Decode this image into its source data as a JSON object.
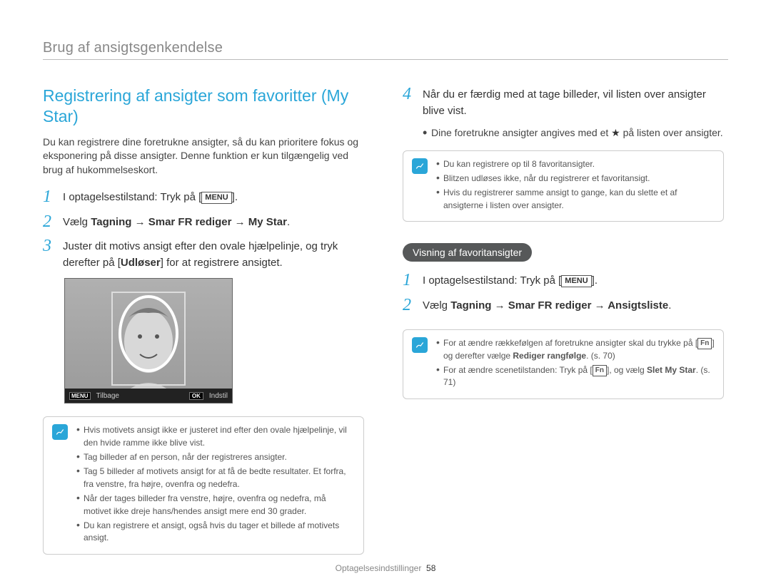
{
  "header": {
    "title": "Brug af ansigtsgenkendelse"
  },
  "left": {
    "title": "Registrering af ansigter som favoritter (My Star)",
    "intro": "Du kan registrere dine foretrukne ansigter, så du kan prioritere fokus og eksponering på disse ansigter. Denne funktion er kun tilgængelig ved brug af hukommelseskort.",
    "step1_pre": "I optagelsestilstand: Tryk på [",
    "step1_btn": "MENU",
    "step1_post": "].",
    "step2_pre": "Vælg ",
    "step2_bold": "Tagning → Smar FR rediger → My Star",
    "step2_post": ".",
    "step3_a": "Juster dit motivs ansigt efter den ovale hjælpelinje, og tryk derefter på [",
    "step3_b": "Udløser",
    "step3_c": "] for at registrere ansigtet.",
    "fig": {
      "back": "Tilbage",
      "set": "Indstil",
      "menu": "MENU",
      "ok": "OK"
    },
    "notes": {
      "n1": "Hvis motivets ansigt ikke er justeret ind efter den ovale hjælpelinje, vil den hvide ramme ikke blive vist.",
      "n2": "Tag billeder af en person, når der registreres ansigter.",
      "n3": "Tag 5 billeder af motivets ansigt for at få de bedte resultater. Et forfra, fra venstre, fra højre, ovenfra og nedefra.",
      "n4": "Når der tages billeder fra venstre, højre, ovenfra og nedefra, må motivet ikke dreje hans/hendes ansigt mere end 30 grader.",
      "n5": "Du kan registrere et ansigt, også hvis du tager et billede af motivets ansigt."
    }
  },
  "right": {
    "step4_a": "Når du er færdig med at tage billeder, vil listen over ansigter blive vist.",
    "step4_bul_a": "Dine foretrukne ansigter angives med et ",
    "step4_bul_b": " på listen over ansigter.",
    "box1": {
      "n1": "Du kan registrere op til 8 favoritansigter.",
      "n2": "Blitzen udløses ikke, når du registrerer et favoritansigt.",
      "n3": "Hvis du registrerer samme ansigt to gange, kan du slette et af ansigterne i listen over ansigter."
    },
    "pill": "Visning af favoritansigter",
    "r_step1_pre": "I optagelsestilstand: Tryk på [",
    "r_step1_btn": "MENU",
    "r_step1_post": "].",
    "r_step2_pre": "Vælg ",
    "r_step2_bold": "Tagning → Smar FR rediger → Ansigtsliste",
    "r_step2_post": ".",
    "box2": {
      "n1_a": "For at ændre rækkefølgen af foretrukne ansigter skal du trykke på [",
      "n1_fn": "Fn",
      "n1_b": "] og derefter vælge ",
      "n1_bold": "Rediger rangfølge",
      "n1_c": ". (s. 70)",
      "n2_a": "For at ændre scenetilstanden: Tryk på [",
      "n2_fn": "Fn",
      "n2_b": "], og vælg ",
      "n2_bold": "Slet My Star",
      "n2_c": ". (s. 71)"
    }
  },
  "footer": {
    "label": "Optagelsesindstillinger",
    "page": "58"
  }
}
